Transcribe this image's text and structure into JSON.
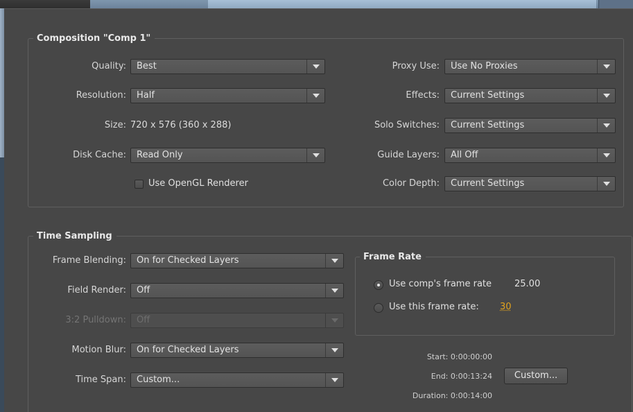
{
  "composition": {
    "title": "Composition \"Comp 1\"",
    "quality": {
      "label": "Quality:",
      "value": "Best"
    },
    "resolution": {
      "label": "Resolution:",
      "value": "Half"
    },
    "size": {
      "label": "Size:",
      "value": "720 x 576 (360 x 288)"
    },
    "disk_cache": {
      "label": "Disk Cache:",
      "value": "Read Only"
    },
    "opengl": {
      "label": "Use OpenGL Renderer",
      "checked": false
    },
    "proxy_use": {
      "label": "Proxy Use:",
      "value": "Use No Proxies"
    },
    "effects": {
      "label": "Effects:",
      "value": "Current Settings"
    },
    "solo_switches": {
      "label": "Solo Switches:",
      "value": "Current Settings"
    },
    "guide_layers": {
      "label": "Guide Layers:",
      "value": "All Off"
    },
    "color_depth": {
      "label": "Color Depth:",
      "value": "Current Settings"
    }
  },
  "time_sampling": {
    "title": "Time Sampling",
    "frame_blending": {
      "label": "Frame Blending:",
      "value": "On for Checked Layers"
    },
    "field_render": {
      "label": "Field Render:",
      "value": "Off"
    },
    "pulldown": {
      "label": "3:2 Pulldown:",
      "value": "Off",
      "disabled": true
    },
    "motion_blur": {
      "label": "Motion Blur:",
      "value": "On for Checked Layers"
    },
    "time_span": {
      "label": "Time Span:",
      "value": "Custom..."
    },
    "frame_rate": {
      "title": "Frame Rate",
      "use_comp": {
        "label": "Use comp's frame rate",
        "value": "25.00",
        "checked": true
      },
      "use_this": {
        "label": "Use this frame rate:",
        "value": "30",
        "checked": false
      }
    },
    "start": "Start: 0:00:00:00",
    "end": "End: 0:00:13:24",
    "duration": "Duration: 0:00:14:00",
    "custom_button": "Custom..."
  },
  "colors": {
    "background": "#474747",
    "hot_value": "#e0a21d"
  }
}
